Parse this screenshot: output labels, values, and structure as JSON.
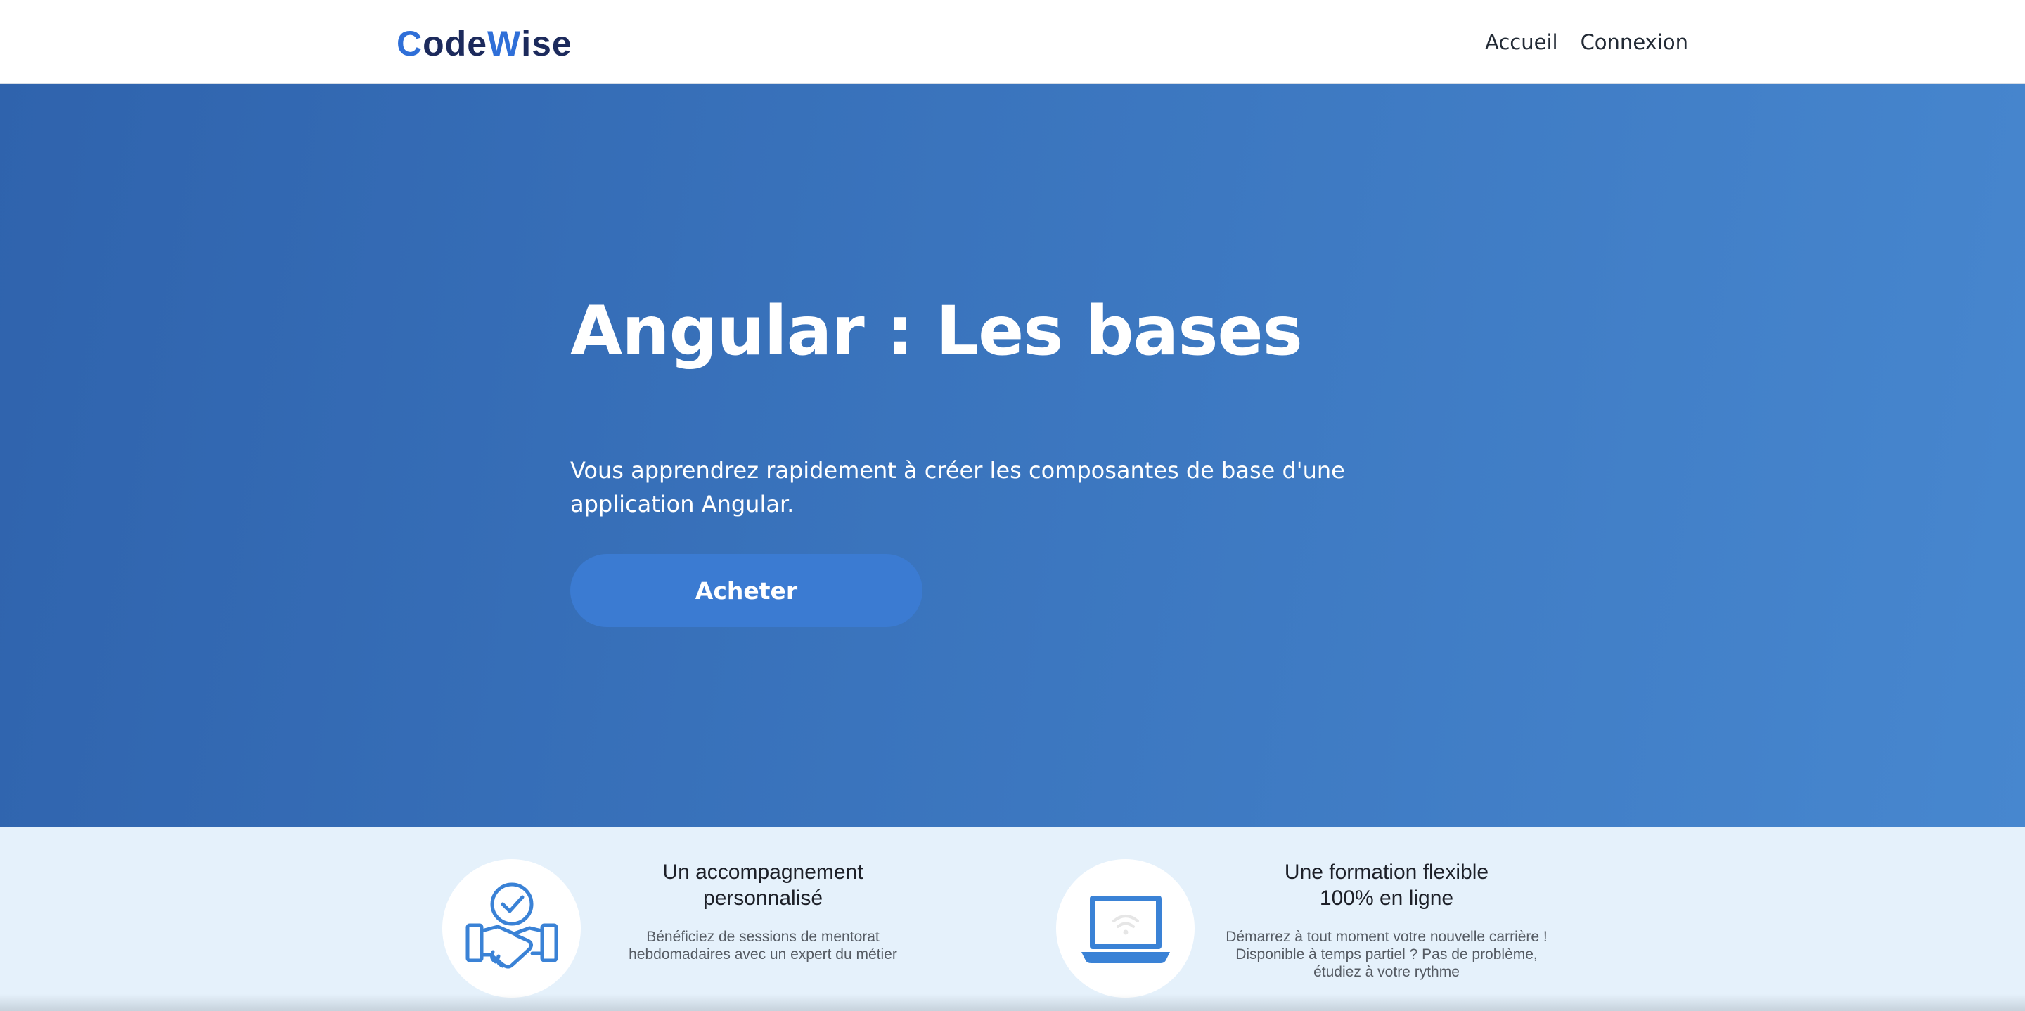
{
  "header": {
    "logo": {
      "first_letter": "C",
      "part1": "ode",
      "accent_letter": "W",
      "part2": "ise"
    },
    "nav": [
      "Accueil",
      "Connexion"
    ]
  },
  "hero": {
    "title": "Angular : Les bases",
    "description": "Vous apprendrez rapidement à créer les composantes de base d'une application Angular.",
    "button_label": "Acheter"
  },
  "features": [
    {
      "icon": "handshake-check-icon",
      "title_line1": "Un accompagnement",
      "title_line2": "personnalisé",
      "desc_line1": "Bénéficiez de sessions de mentorat",
      "desc_line2": "hebdomadaires avec un expert du métier",
      "desc_line3": ""
    },
    {
      "icon": "laptop-wifi-icon",
      "title_line1": "Une formation flexible",
      "title_line2": "100% en ligne",
      "desc_line1": "Démarrez à tout moment votre nouvelle carrière !",
      "desc_line2": "Disponible à temps partiel ? Pas de problème,",
      "desc_line3": "étudiez à votre rythme"
    }
  ],
  "colors": {
    "brand_dark": "#1c2a5c",
    "brand_accent": "#2f6fd8",
    "hero_start": "#2f63ad",
    "hero_end": "#4787cf",
    "button": "#3b7bd2",
    "features_bg": "#e5f1fb"
  }
}
